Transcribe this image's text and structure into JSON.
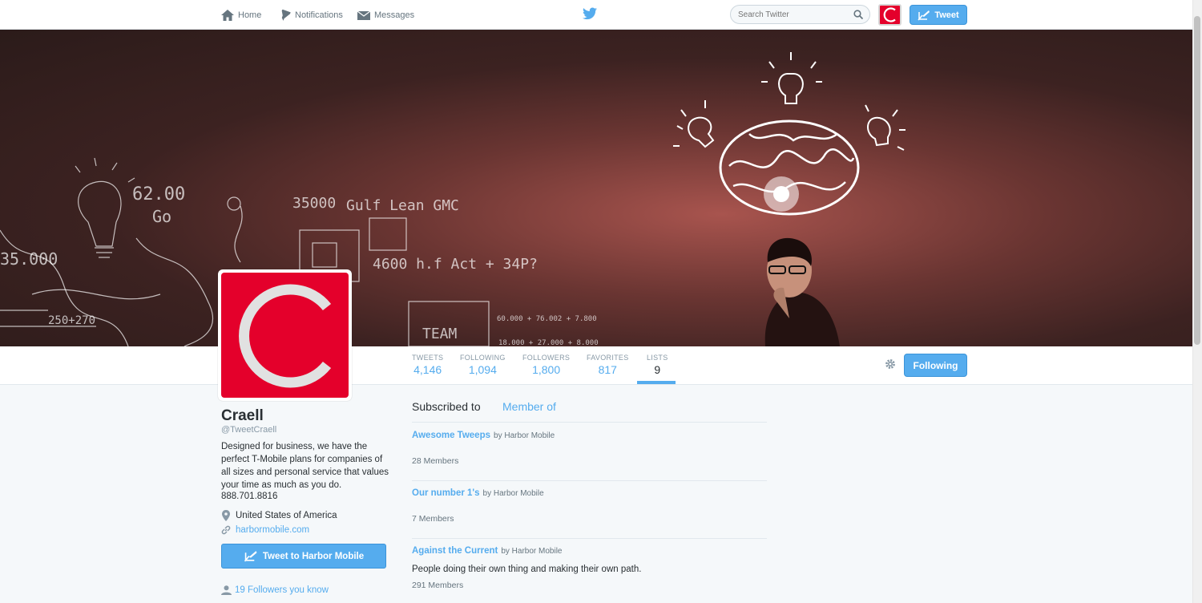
{
  "nav": {
    "home": "Home",
    "notifications": "Notifications",
    "messages": "Messages",
    "search_placeholder": "Search Twitter",
    "tweet_button": "Tweet"
  },
  "stats": [
    {
      "label": "TWEETS",
      "value": "4,146"
    },
    {
      "label": "FOLLOWING",
      "value": "1,094"
    },
    {
      "label": "FOLLOWERS",
      "value": "1,800"
    },
    {
      "label": "FAVORITES",
      "value": "817"
    },
    {
      "label": "LISTS",
      "value": "9"
    }
  ],
  "follow_button": "Following",
  "profile": {
    "name": "Craell",
    "handle": "@TweetCraell",
    "bio": "Designed for business, we have the perfect T-Mobile plans for companies of all sizes and personal service that values your time as much as you do.",
    "phone": "888.701.8816",
    "location": "United States of America",
    "website": "harbormobile.com",
    "tweet_to": "Tweet to Harbor Mobile",
    "followers_you_know": "19 Followers you know"
  },
  "tabs": {
    "subscribed": "Subscribed to",
    "member_of": "Member of"
  },
  "lists": [
    {
      "title": "Awesome Tweeps",
      "by": "by Harbor Mobile",
      "description": "",
      "members": "28 Members"
    },
    {
      "title": "Our number 1's",
      "by": "by Harbor Mobile",
      "description": "",
      "members": "7 Members"
    },
    {
      "title": "Against the Current",
      "by": "by Harbor Mobile",
      "description": "People doing their own thing and making their own path.",
      "members": "291 Members"
    }
  ],
  "banner_sketch_text": [
    "62.00",
    "Go",
    "35000",
    "Gulf Lean GMC",
    "4600 h.f Act + 34P?",
    "35.000",
    "250+270",
    "TEAM",
    "60.000 + 76.002 + 7.800",
    "18.000 + 27.000 + 8.000"
  ],
  "colors": {
    "accent": "#55acee",
    "brand_red": "#e4002b",
    "text": "#292f33",
    "muted": "#8899a6"
  }
}
